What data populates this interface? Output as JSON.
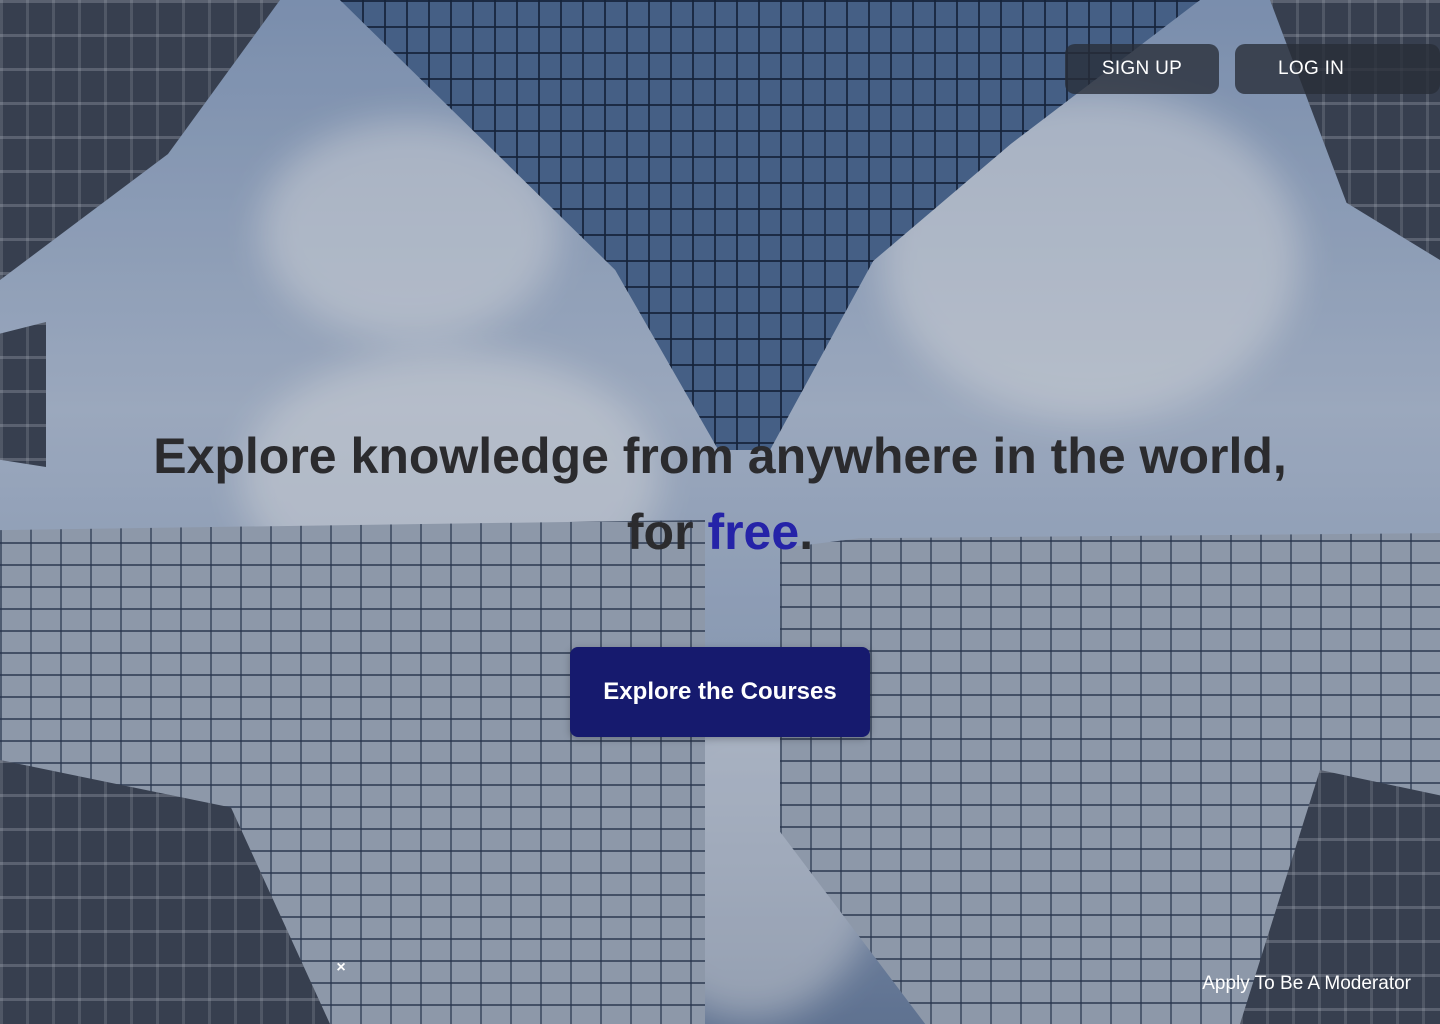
{
  "nav": {
    "signup_label": "SIGN UP",
    "login_label": "LOG IN"
  },
  "hero": {
    "headline_line1": "Explore knowledge from anywhere in the world,",
    "headline_for": "for ",
    "headline_accent": "free",
    "headline_period": ".",
    "cta_label": "Explore the Courses",
    "accent_color": "#2523a8",
    "cta_color": "#161a6e"
  },
  "footer": {
    "close_icon": "×",
    "moderator_label": "Apply To Be A Moderator"
  }
}
